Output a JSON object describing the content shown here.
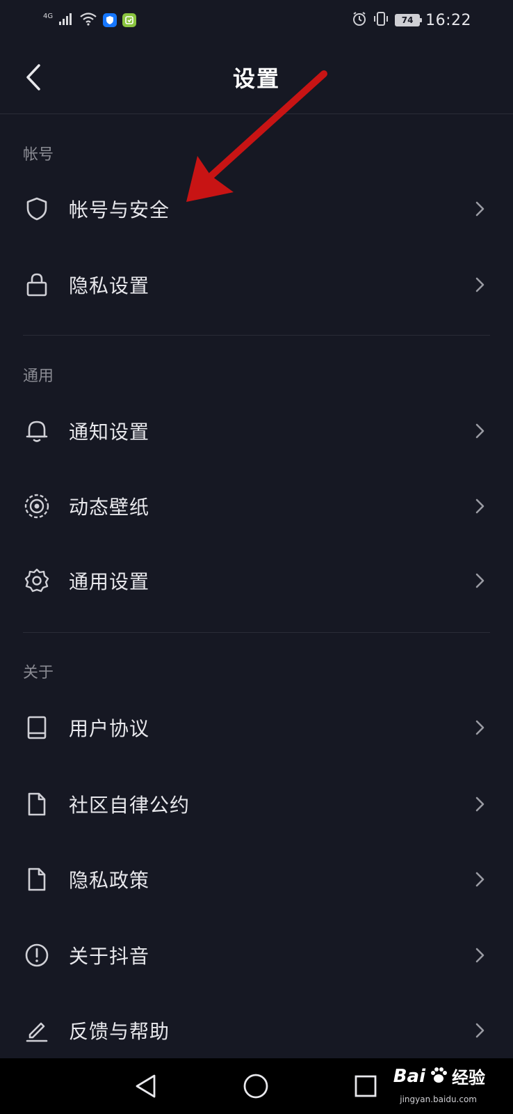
{
  "status_bar": {
    "network": "4G",
    "time": "16:22",
    "battery": "74"
  },
  "header": {
    "title": "设置"
  },
  "sections": [
    {
      "title": "帐号",
      "items": [
        {
          "label": "帐号与安全",
          "icon": "shield-icon"
        },
        {
          "label": "隐私设置",
          "icon": "lock-icon"
        }
      ]
    },
    {
      "title": "通用",
      "items": [
        {
          "label": "通知设置",
          "icon": "bell-icon"
        },
        {
          "label": "动态壁纸",
          "icon": "live-wallpaper-icon"
        },
        {
          "label": "通用设置",
          "icon": "gear-icon"
        }
      ]
    },
    {
      "title": "关于",
      "items": [
        {
          "label": "用户协议",
          "icon": "book-icon"
        },
        {
          "label": "社区自律公约",
          "icon": "document-icon"
        },
        {
          "label": "隐私政策",
          "icon": "document-icon"
        },
        {
          "label": "关于抖音",
          "icon": "info-icon"
        },
        {
          "label": "反馈与帮助",
          "icon": "edit-icon"
        }
      ]
    }
  ],
  "watermark": {
    "logo_text": "Bai",
    "logo_suffix": "经验",
    "url": "jingyan.baidu.com"
  },
  "colors": {
    "background": "#161823",
    "text": "#e8e8ec",
    "section_title": "#8a8b93",
    "annotation_arrow": "#c81414"
  }
}
